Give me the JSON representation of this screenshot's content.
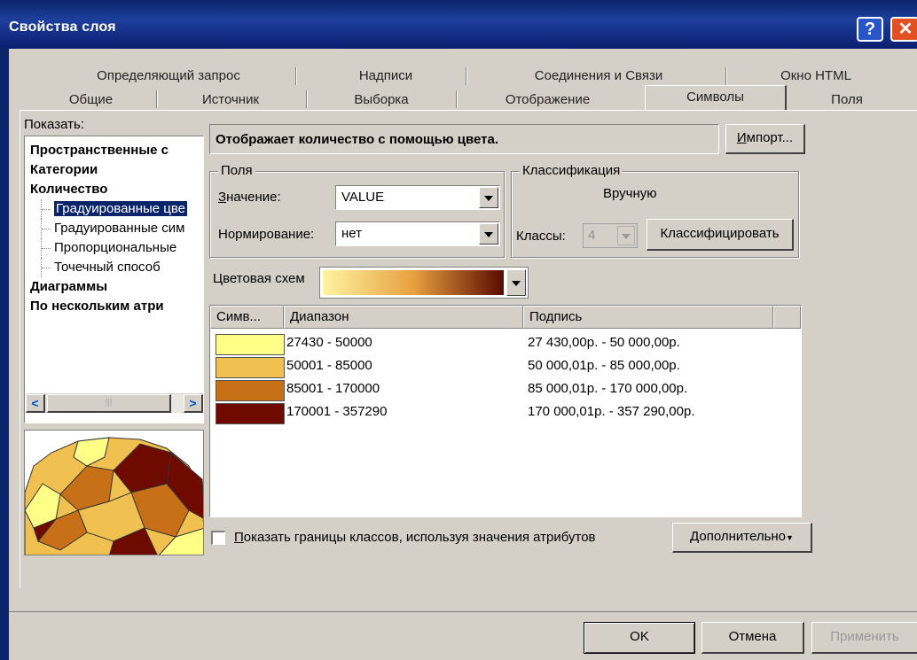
{
  "window": {
    "title": "Свойства слоя",
    "help_glyph": "?",
    "close_glyph": "✕"
  },
  "tabs": {
    "row1": [
      "Определяющий запрос",
      "Надписи",
      "Соединения и Связи",
      "Окно HTML"
    ],
    "row2": [
      "Общие",
      "Источник",
      "Выборка",
      "Отображение",
      "Символы",
      "Поля"
    ],
    "active": "Символы"
  },
  "left": {
    "show_label": "Показать:",
    "tree": [
      {
        "label": "Пространственные с",
        "bold": true
      },
      {
        "label": "Категории",
        "bold": true
      },
      {
        "label": "Количество",
        "bold": true
      },
      {
        "label": "Градуированные цве",
        "bold": false,
        "selected": true
      },
      {
        "label": "Градуированные сим",
        "bold": false
      },
      {
        "label": "Пропорциональные",
        "bold": false
      },
      {
        "label": "Точечный способ",
        "bold": false
      },
      {
        "label": "Диаграммы",
        "bold": true
      },
      {
        "label": "По нескольким атри",
        "bold": true
      }
    ],
    "scroll_left": "<",
    "scroll_right": ">"
  },
  "description": "Отображает количество с помощью цвета.",
  "import_button": "Импорт...",
  "fields": {
    "group_label": "Поля",
    "value_label": "Значение:",
    "value": "VALUE",
    "normalize_label": "Нормирование:",
    "normalize": "нет"
  },
  "classification": {
    "group_label": "Классификация",
    "method": "Вручную",
    "classes_label": "Классы:",
    "classes_value": "4",
    "classify_button": "Классифицировать"
  },
  "color_scheme_label": "Цветовая схем",
  "colors": {
    "ramp_start": "#fff4a0",
    "ramp_mid": "#e8a040",
    "ramp_end": "#5a0a00"
  },
  "table": {
    "headers": [
      "Симв...",
      "Диапазон",
      "Подпись"
    ],
    "rows": [
      {
        "color": "#ffff88",
        "range": "27430 - 50000",
        "label": "27 430,00р. - 50 000,00р."
      },
      {
        "color": "#f0c050",
        "range": "50001 - 85000",
        "label": "50 000,01р. - 85 000,00р."
      },
      {
        "color": "#c87018",
        "range": "85001 - 170000",
        "label": "85 000,01р. - 170 000,00р."
      },
      {
        "color": "#6e0a00",
        "range": "170001 - 357290",
        "label": "170 000,01р. - 357 290,00р."
      }
    ]
  },
  "show_bounds_label": "Показать границы классов, используя значения атрибутов",
  "advanced_button": "Дополнительно",
  "footer": {
    "ok": "OK",
    "cancel": "Отмена",
    "apply": "Применить"
  }
}
